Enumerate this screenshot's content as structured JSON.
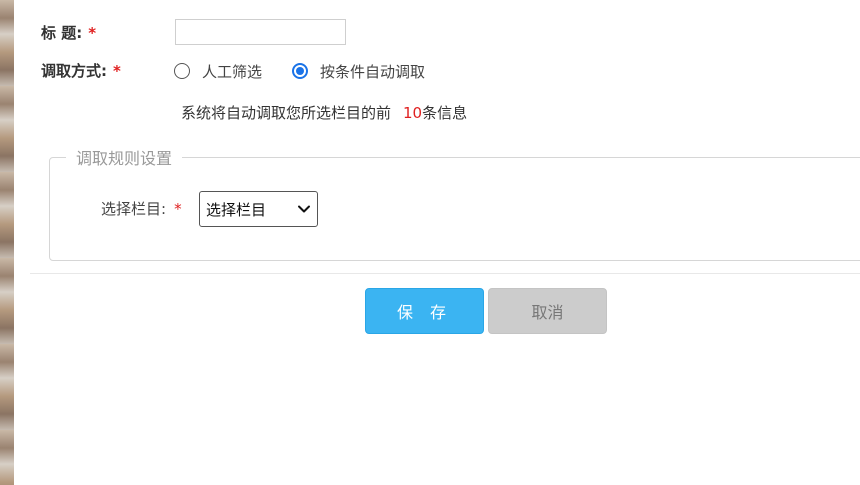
{
  "form": {
    "title_label": "标 题:",
    "required_mark": "*",
    "method_label": "调取方式:",
    "radio_options": [
      {
        "label": "人工筛选",
        "checked": false
      },
      {
        "label": "按条件自动调取",
        "checked": true
      }
    ],
    "info_prefix": "系统将自动调取您所选栏目的前",
    "info_count": "10",
    "info_suffix": "条信息",
    "rules_legend": "调取规则设置",
    "column_label": "选择栏目:",
    "column_select_value": "选择栏目",
    "save_label": "保 存",
    "cancel_label": "取消"
  },
  "colors": {
    "accent": "#1a73e8",
    "required": "#e02020",
    "save_button": "#3bb4f2",
    "cancel_button": "#cccccc"
  }
}
